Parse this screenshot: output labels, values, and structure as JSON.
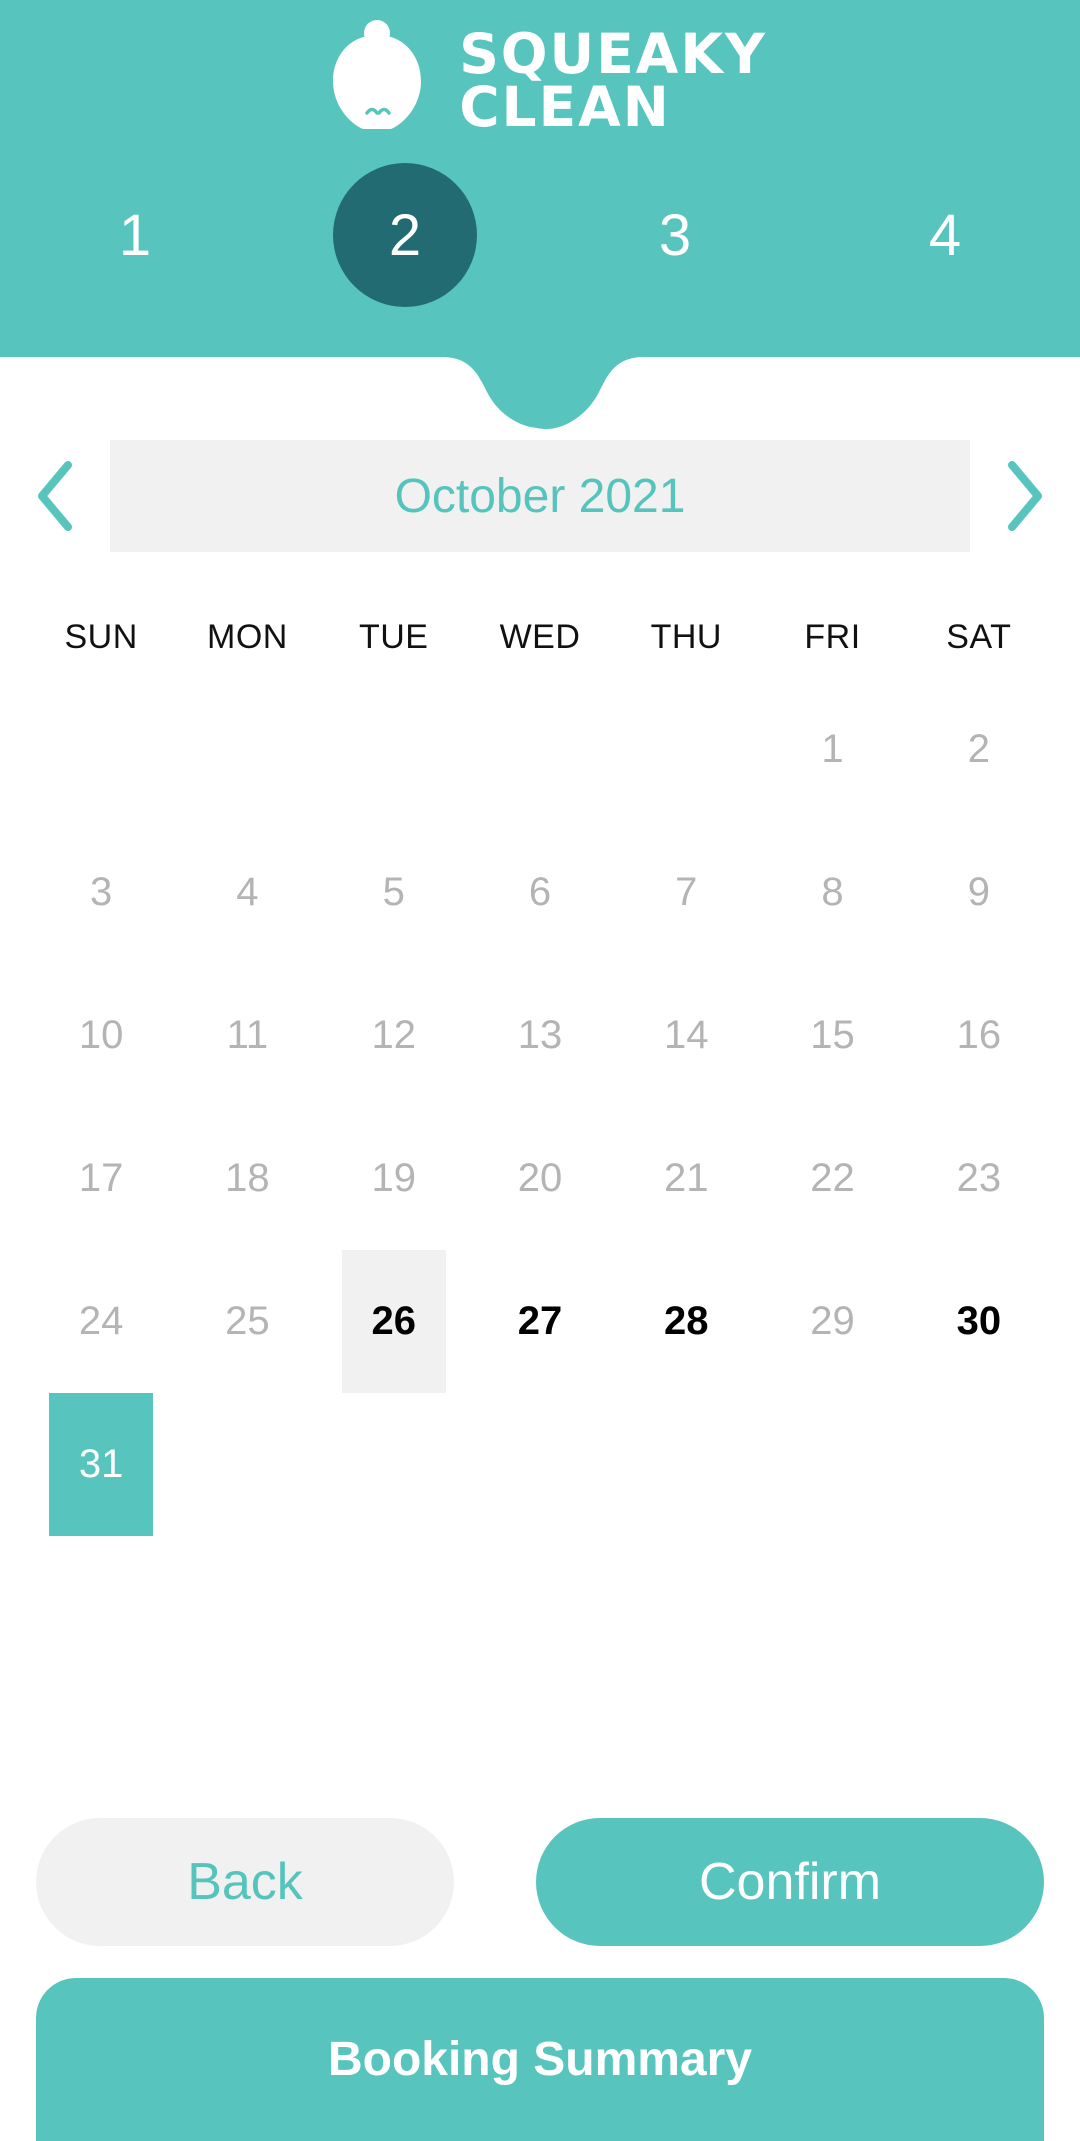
{
  "brand": {
    "logo_icon": "squeaky-clean-mascot-icon",
    "name_line1": "SQUEAKY",
    "name_line2": "CLEAN",
    "teal": "#57c5bd",
    "dark_teal": "#236b72",
    "light_gray": "#f1f1f1",
    "disabled_gray": "#b4b4b4"
  },
  "stepper": {
    "active_index": 1,
    "steps": [
      {
        "label": "1",
        "active": false
      },
      {
        "label": "2",
        "active": true
      },
      {
        "label": "3",
        "active": false
      },
      {
        "label": "4",
        "active": false
      }
    ]
  },
  "month_nav": {
    "prev_icon": "chevron-left-icon",
    "next_icon": "chevron-right-icon",
    "current_month": "October 2021"
  },
  "calendar": {
    "weekday_headers": [
      "SUN",
      "MON",
      "TUE",
      "WED",
      "THU",
      "FRI",
      "SAT"
    ],
    "weeks": [
      [
        {
          "label": "",
          "state": "empty"
        },
        {
          "label": "",
          "state": "empty"
        },
        {
          "label": "",
          "state": "empty"
        },
        {
          "label": "",
          "state": "empty"
        },
        {
          "label": "",
          "state": "empty"
        },
        {
          "label": "1",
          "state": "disabled"
        },
        {
          "label": "2",
          "state": "disabled"
        }
      ],
      [
        {
          "label": "3",
          "state": "disabled"
        },
        {
          "label": "4",
          "state": "disabled"
        },
        {
          "label": "5",
          "state": "disabled"
        },
        {
          "label": "6",
          "state": "disabled"
        },
        {
          "label": "7",
          "state": "disabled"
        },
        {
          "label": "8",
          "state": "disabled"
        },
        {
          "label": "9",
          "state": "disabled"
        }
      ],
      [
        {
          "label": "10",
          "state": "disabled"
        },
        {
          "label": "11",
          "state": "disabled"
        },
        {
          "label": "12",
          "state": "disabled"
        },
        {
          "label": "13",
          "state": "disabled"
        },
        {
          "label": "14",
          "state": "disabled"
        },
        {
          "label": "15",
          "state": "disabled"
        },
        {
          "label": "16",
          "state": "disabled"
        }
      ],
      [
        {
          "label": "17",
          "state": "disabled"
        },
        {
          "label": "18",
          "state": "disabled"
        },
        {
          "label": "19",
          "state": "disabled"
        },
        {
          "label": "20",
          "state": "disabled"
        },
        {
          "label": "21",
          "state": "disabled"
        },
        {
          "label": "22",
          "state": "disabled"
        },
        {
          "label": "23",
          "state": "disabled"
        }
      ],
      [
        {
          "label": "24",
          "state": "disabled"
        },
        {
          "label": "25",
          "state": "disabled"
        },
        {
          "label": "26",
          "state": "today"
        },
        {
          "label": "27",
          "state": "enabled"
        },
        {
          "label": "28",
          "state": "enabled"
        },
        {
          "label": "29",
          "state": "disabled"
        },
        {
          "label": "30",
          "state": "enabled"
        }
      ],
      [
        {
          "label": "31",
          "state": "selected"
        },
        {
          "label": "",
          "state": "empty"
        },
        {
          "label": "",
          "state": "empty"
        },
        {
          "label": "",
          "state": "empty"
        },
        {
          "label": "",
          "state": "empty"
        },
        {
          "label": "",
          "state": "empty"
        },
        {
          "label": "",
          "state": "empty"
        }
      ]
    ],
    "selected_day": "31"
  },
  "actions": {
    "back_label": "Back",
    "confirm_label": "Confirm"
  },
  "footer": {
    "title": "Booking Summary"
  }
}
